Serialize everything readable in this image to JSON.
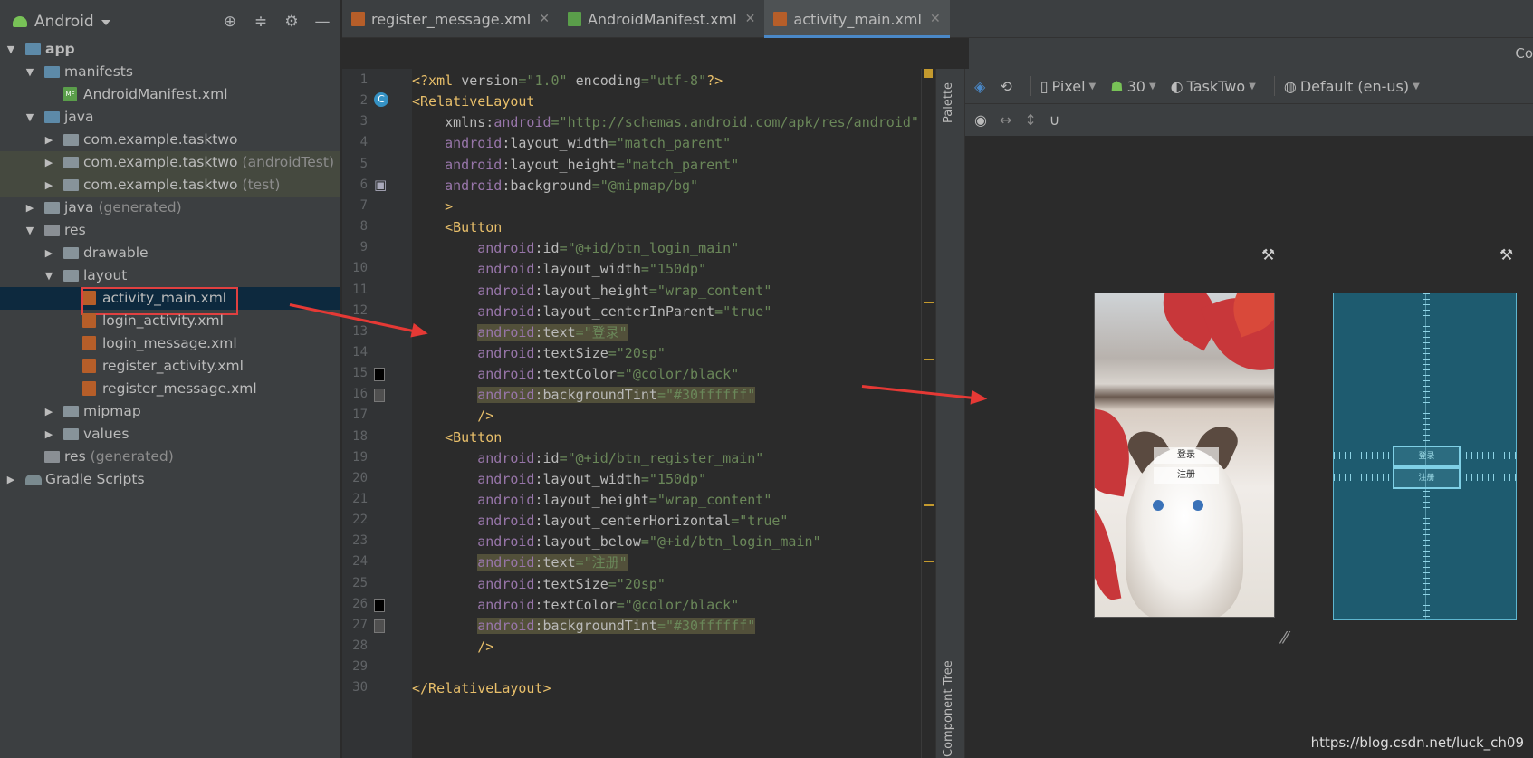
{
  "project": {
    "title": "Android",
    "tools": [
      "⊕",
      "≑",
      "⚙",
      "—"
    ],
    "tree": [
      {
        "label": "app",
        "suffix": "",
        "depth": 0,
        "arrow": "▼",
        "icon": "folder-app"
      },
      {
        "label": "manifests",
        "suffix": "",
        "depth": 1,
        "arrow": "▼",
        "icon": "folder-blue"
      },
      {
        "label": "AndroidManifest.xml",
        "suffix": "",
        "depth": 2,
        "arrow": "",
        "icon": "manifest"
      },
      {
        "label": "java",
        "suffix": "",
        "depth": 1,
        "arrow": "▼",
        "icon": "folder-blue"
      },
      {
        "label": "com.example.tasktwo",
        "suffix": "",
        "depth": 2,
        "arrow": "▶",
        "icon": "folder"
      },
      {
        "label": "com.example.tasktwo",
        "suffix": "(androidTest)",
        "depth": 2,
        "arrow": "▶",
        "icon": "folder"
      },
      {
        "label": "com.example.tasktwo",
        "suffix": "(test)",
        "depth": 2,
        "arrow": "▶",
        "icon": "folder"
      },
      {
        "label": "java",
        "suffix": "(generated)",
        "depth": 1,
        "arrow": "▶",
        "icon": "folder"
      },
      {
        "label": "res",
        "suffix": "",
        "depth": 1,
        "arrow": "▼",
        "icon": "folder-res"
      },
      {
        "label": "drawable",
        "suffix": "",
        "depth": 2,
        "arrow": "▶",
        "icon": "folder"
      },
      {
        "label": "layout",
        "suffix": "",
        "depth": 2,
        "arrow": "▼",
        "icon": "folder"
      },
      {
        "label": "activity_main.xml",
        "suffix": "",
        "depth": 3,
        "arrow": "",
        "icon": "xml"
      },
      {
        "label": "login_activity.xml",
        "suffix": "",
        "depth": 3,
        "arrow": "",
        "icon": "xml"
      },
      {
        "label": "login_message.xml",
        "suffix": "",
        "depth": 3,
        "arrow": "",
        "icon": "xml"
      },
      {
        "label": "register_activity.xml",
        "suffix": "",
        "depth": 3,
        "arrow": "",
        "icon": "xml"
      },
      {
        "label": "register_message.xml",
        "suffix": "",
        "depth": 3,
        "arrow": "",
        "icon": "xml"
      },
      {
        "label": "mipmap",
        "suffix": "",
        "depth": 2,
        "arrow": "▶",
        "icon": "folder"
      },
      {
        "label": "values",
        "suffix": "",
        "depth": 2,
        "arrow": "▶",
        "icon": "folder"
      },
      {
        "label": "res",
        "suffix": "(generated)",
        "depth": 1,
        "arrow": "",
        "icon": "folder-res"
      },
      {
        "label": "Gradle Scripts",
        "suffix": "",
        "depth": 0,
        "arrow": "▶",
        "icon": "gradle"
      }
    ],
    "selected_index": 11,
    "highlighted_indices": [
      5,
      6
    ]
  },
  "tabs": [
    {
      "label": "register_message.xml",
      "icon": "xml",
      "active": false
    },
    {
      "label": "AndroidManifest.xml",
      "icon": "manifest",
      "active": false
    },
    {
      "label": "activity_main.xml",
      "icon": "xml",
      "active": true
    }
  ],
  "right_tab_label": "Co",
  "code_lines": [
    {
      "n": "1",
      "html": "<span class='pi'>&lt;?xml </span><span class='at'>version</span><span class='v'>=\"1.0\"</span><span class='at'> encoding</span><span class='v'>=\"utf-8\"</span><span class='pi'>?&gt;</span>"
    },
    {
      "n": "2",
      "html": "<span class='t'>&lt;RelativeLayout</span>"
    },
    {
      "n": "3",
      "html": "    <span class='at'>xmlns:</span><span class='ns'>android</span><span class='v'>=\"http://schemas.android.com/apk/res/android\"</span>"
    },
    {
      "n": "4",
      "html": "    <span class='ns'>android</span><span class='at'>:layout_width</span><span class='v'>=\"match_parent\"</span>"
    },
    {
      "n": "5",
      "html": "    <span class='ns'>android</span><span class='at'>:layout_height</span><span class='v'>=\"match_parent\"</span>"
    },
    {
      "n": "6",
      "html": "    <span class='ns'>android</span><span class='at'>:background</span><span class='v'>=\"@mipmap/bg\"</span>"
    },
    {
      "n": "7",
      "html": "    <span class='t'>&gt;</span>"
    },
    {
      "n": "8",
      "html": "    <span class='t'>&lt;Button</span>"
    },
    {
      "n": "9",
      "html": "        <span class='ns'>android</span><span class='at'>:id</span><span class='v'>=\"@+id/btn_login_main\"</span>"
    },
    {
      "n": "10",
      "html": "        <span class='ns'>android</span><span class='at'>:layout_width</span><span class='v'>=\"150dp\"</span>"
    },
    {
      "n": "11",
      "html": "        <span class='ns'>android</span><span class='at'>:layout_height</span><span class='v'>=\"wrap_content\"</span>"
    },
    {
      "n": "12",
      "html": "        <span class='ns'>android</span><span class='at'>:layout_centerInParent</span><span class='v'>=\"true\"</span>"
    },
    {
      "n": "13",
      "html": "        <span class='hl'><span class='ns'>android</span><span class='at'>:text</span><span class='v'>=\"登录\"</span></span>"
    },
    {
      "n": "14",
      "html": "        <span class='ns'>android</span><span class='at'>:textSize</span><span class='v'>=\"20sp\"</span>"
    },
    {
      "n": "15",
      "html": "        <span class='ns'>android</span><span class='at'>:textColor</span><span class='v'>=\"@color/black\"</span>"
    },
    {
      "n": "16",
      "html": "        <span class='hl'><span class='ns'>android</span><span class='at'>:backgroundTint</span><span class='v'>=\"#30ffffff\"</span></span>"
    },
    {
      "n": "17",
      "html": "        <span class='t'>/&gt;</span>"
    },
    {
      "n": "18",
      "html": "    <span class='t'>&lt;Button</span>"
    },
    {
      "n": "19",
      "html": "        <span class='ns'>android</span><span class='at'>:id</span><span class='v'>=\"@+id/btn_register_main\"</span>"
    },
    {
      "n": "20",
      "html": "        <span class='ns'>android</span><span class='at'>:layout_width</span><span class='v'>=\"150dp\"</span>"
    },
    {
      "n": "21",
      "html": "        <span class='ns'>android</span><span class='at'>:layout_height</span><span class='v'>=\"wrap_content\"</span>"
    },
    {
      "n": "22",
      "html": "        <span class='ns'>android</span><span class='at'>:layout_centerHorizontal</span><span class='v'>=\"true\"</span>"
    },
    {
      "n": "23",
      "html": "        <span class='ns'>android</span><span class='at'>:layout_below</span><span class='v'>=\"@+id/btn_login_main\"</span>"
    },
    {
      "n": "24",
      "html": "        <span class='hl'><span class='ns'>android</span><span class='at'>:text</span><span class='v'>=\"注册\"</span></span>"
    },
    {
      "n": "25",
      "html": "        <span class='ns'>android</span><span class='at'>:textSize</span><span class='v'>=\"20sp\"</span>"
    },
    {
      "n": "26",
      "html": "        <span class='ns'>android</span><span class='at'>:textColor</span><span class='v'>=\"@color/black\"</span>"
    },
    {
      "n": "27",
      "html": "        <span class='hl'><span class='ns'>android</span><span class='at'>:backgroundTint</span><span class='v'>=\"#30ffffff\"</span></span>"
    },
    {
      "n": "28",
      "html": "        <span class='t'>/&gt;</span>"
    },
    {
      "n": "29",
      "html": ""
    },
    {
      "n": "30",
      "html": "<span class='t'>&lt;/RelativeLayout&gt;</span>"
    }
  ],
  "gutter_icons": {
    "2": "C",
    "6": "▣",
    "15": "■",
    "16": "■",
    "26": "■",
    "27": "■"
  },
  "palette_label": "Palette",
  "component_tree_label": "Component Tree",
  "design_toolbar": {
    "device": "Pixel",
    "api": "30",
    "theme": "TaskTwo",
    "locale": "Default (en-us)"
  },
  "preview": {
    "login_text": "登录",
    "register_text": "注册"
  },
  "watermark": "https://blog.csdn.net/luck_ch09",
  "colors": {
    "accent": "#4a88c7",
    "selection_box": "#e04040",
    "arrow": "#e53935",
    "blueprint": "#1e5b6f"
  }
}
